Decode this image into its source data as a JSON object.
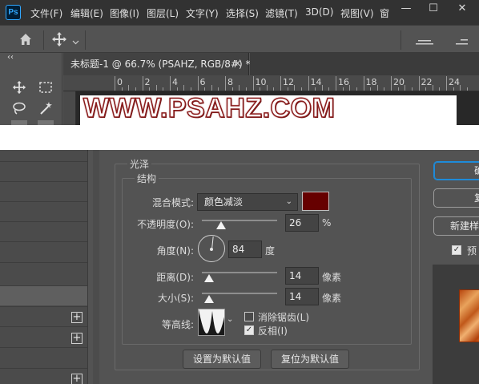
{
  "app": {
    "logo": "Ps",
    "menu": [
      "文件(F)",
      "编辑(E)",
      "图像(I)",
      "图层(L)",
      "文字(Y)",
      "选择(S)",
      "滤镜(T)",
      "3D(D)",
      "视图(V)",
      "窗"
    ],
    "window_controls": [
      "—",
      "☐",
      "✕"
    ],
    "toolpanel_collapse": "‹‹"
  },
  "document": {
    "tab_title": "未标题-1 @ 66.7% (PSAHZ, RGB/8#) *",
    "tab_close": "×",
    "canvas_text": "WWW.PSAHZ.COM",
    "ruler_numbers": [
      "0",
      "2",
      "4",
      "6",
      "8",
      "10",
      "12",
      "14",
      "16",
      "18",
      "20",
      "22",
      "24"
    ]
  },
  "layer_style": {
    "section_title": "光泽",
    "group_title": "结构",
    "blend_mode": {
      "label": "混合模式:",
      "value": "颜色减淡",
      "color": "#660000"
    },
    "opacity": {
      "label": "不透明度(O):",
      "value": "26",
      "unit": "%",
      "level": 0.26
    },
    "angle": {
      "label": "角度(N):",
      "value": "84",
      "unit": "度",
      "degrees": 84
    },
    "distance": {
      "label": "距离(D):",
      "value": "14",
      "unit": "像素",
      "level": 0.1
    },
    "size": {
      "label": "大小(S):",
      "value": "14",
      "unit": "像素",
      "level": 0.1
    },
    "contour": {
      "label": "等高线:",
      "anti_alias": {
        "label": "消除锯齿(L)",
        "checked": false
      },
      "invert": {
        "label": "反相(I)",
        "checked": true
      }
    },
    "buttons": {
      "make_default": "设置为默认值",
      "reset_default": "复位为默认值"
    },
    "right_buttons": [
      "确",
      "复",
      "新建样"
    ],
    "preview_label": "预",
    "left_list_plus": [
      "+",
      "+",
      "+"
    ]
  }
}
